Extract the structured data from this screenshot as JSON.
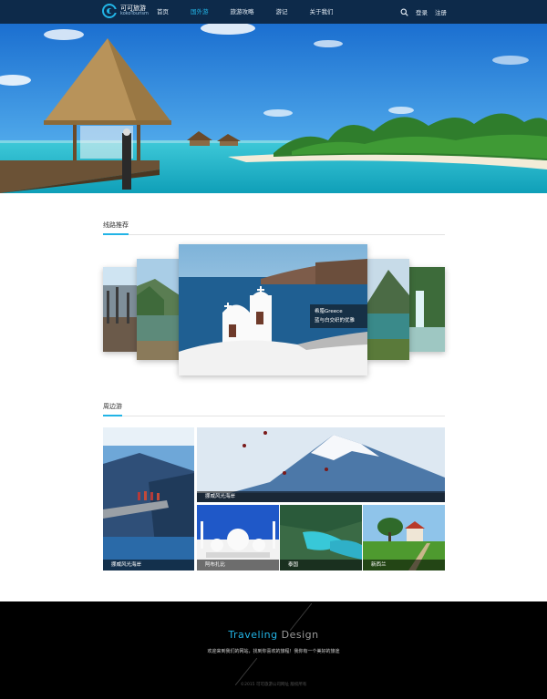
{
  "header": {
    "logo_cn": "可可旅游",
    "logo_en": "kokoTourism",
    "nav": [
      {
        "label": "首页",
        "active": false
      },
      {
        "label": "国外游",
        "active": true
      },
      {
        "label": "旅游攻略",
        "active": false
      },
      {
        "label": "游记",
        "active": false
      },
      {
        "label": "关于我们",
        "active": false
      }
    ],
    "login": "登录",
    "register": "注册",
    "search_icon": "search-icon"
  },
  "routes": {
    "title": "线路推荐",
    "featured_caption_line1": "希腊Greece",
    "featured_caption_line2": "蓝与白交织的优雅"
  },
  "nearby": {
    "title": "周边游",
    "tiles": [
      {
        "label": "挪威风光海岸"
      },
      {
        "label": "挪威风光海岸"
      },
      {
        "label": "阿布扎比"
      },
      {
        "label": "泰国"
      },
      {
        "label": "新西兰"
      }
    ]
  },
  "footer": {
    "brand_1": "Traveling",
    "brand_2": "Design",
    "slogan": "欢迎来到我们的网站，找到你喜欢的旅程！我你有一个美好的旅途",
    "copyright": "©2015 可可旅游公司网址 版权所有"
  },
  "colors": {
    "accent": "#22b4e6",
    "header_bg": "#0d2a4a",
    "footer_bg": "#000000"
  }
}
